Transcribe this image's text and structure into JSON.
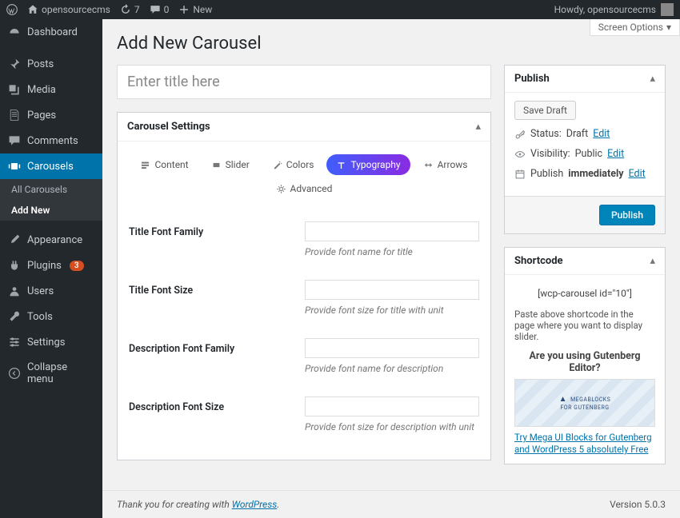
{
  "adminbar": {
    "site_name": "opensourcecms",
    "revisions": "7",
    "comments": "0",
    "new_label": "New",
    "howdy": "Howdy, opensourcecms"
  },
  "sidebar": {
    "dashboard": "Dashboard",
    "posts": "Posts",
    "media": "Media",
    "pages": "Pages",
    "comments": "Comments",
    "carousels": "Carousels",
    "all_carousels": "All Carousels",
    "add_new": "Add New",
    "appearance": "Appearance",
    "plugins": "Plugins",
    "plugins_badge": "3",
    "users": "Users",
    "tools": "Tools",
    "settings": "Settings",
    "collapse": "Collapse menu"
  },
  "screen_options": "Screen Options",
  "page_title": "Add New Carousel",
  "title_placeholder": "Enter title here",
  "carousel_settings": {
    "title": "Carousel Settings",
    "tabs": {
      "content": "Content",
      "slider": "Slider",
      "colors": "Colors",
      "typography": "Typography",
      "arrows": "Arrows",
      "advanced": "Advanced"
    },
    "fields": {
      "title_font_family": {
        "label": "Title Font Family",
        "help": "Provide font name for title",
        "value": ""
      },
      "title_font_size": {
        "label": "Title Font Size",
        "help": "Provide font size for title with unit",
        "value": ""
      },
      "desc_font_family": {
        "label": "Description Font Family",
        "help": "Provide font name for description",
        "value": ""
      },
      "desc_font_size": {
        "label": "Description Font Size",
        "help": "Provide font size for description with unit",
        "value": ""
      }
    }
  },
  "publish": {
    "title": "Publish",
    "save_draft": "Save Draft",
    "status_label": "Status:",
    "status_value": "Draft",
    "visibility_label": "Visibility:",
    "visibility_value": "Public",
    "publish_label": "Publish",
    "publish_value": "immediately",
    "edit": "Edit",
    "publish_btn": "Publish"
  },
  "shortcode": {
    "title": "Shortcode",
    "code": "[wcp-carousel id=\"10\"]",
    "help": "Paste above shortcode in the page where you want to display slider.",
    "gutenberg_title": "Are you using Gutenberg Editor?",
    "logo_main": "MEGABLOCKS",
    "logo_sub": "FOR GUTENBERG",
    "link": "Try Mega UI Blocks for Gutenberg and WordPress 5 absolutely Free"
  },
  "footer": {
    "thanks": "Thank you for creating with ",
    "wp": "WordPress",
    "version": "Version 5.0.3"
  }
}
